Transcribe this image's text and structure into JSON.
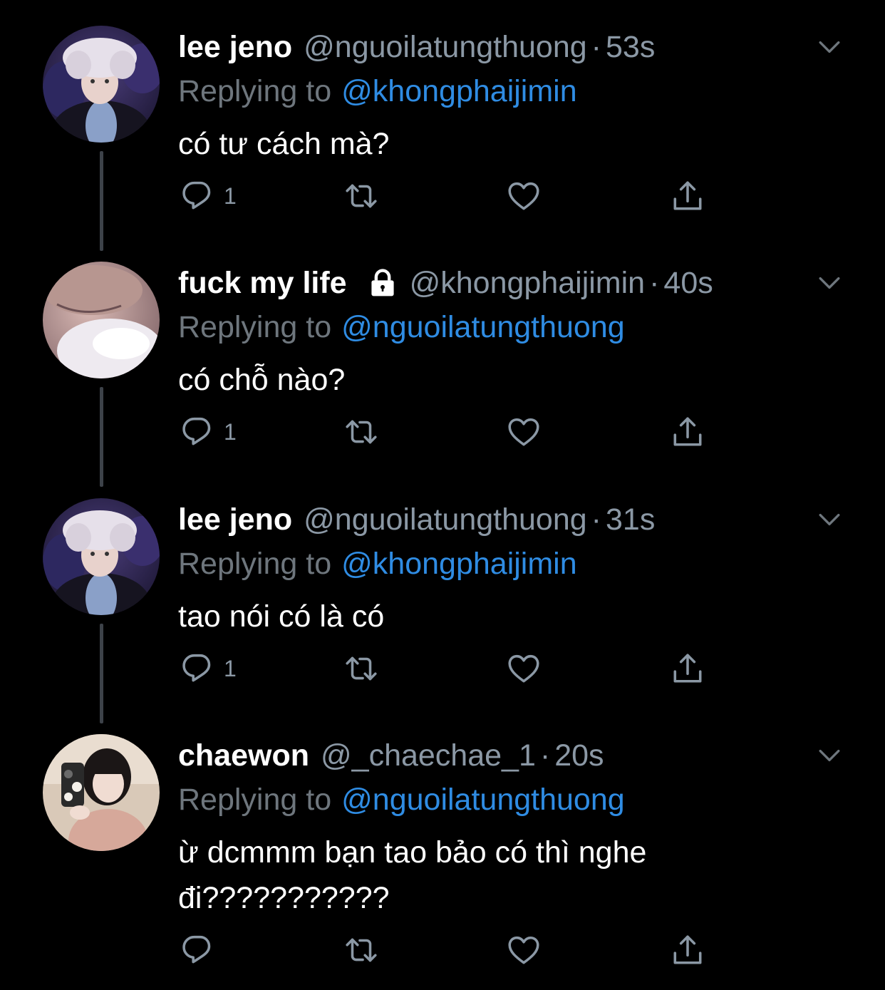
{
  "colors": {
    "background": "#000000",
    "name": "#ffffff",
    "secondary": "#8b98a5",
    "mention": "#2f8ce3",
    "thread_line": "#3d4249"
  },
  "tweets": [
    {
      "display_name": "lee jeno",
      "handle": "@nguoilatungthuong",
      "separator": "·",
      "time": "53s",
      "locked": false,
      "replying_label": "Replying to",
      "replying_to": "@khongphaijimin",
      "text": "có tư cách mà?",
      "reply_count": "1",
      "avatar": "avatar-lee-jeno"
    },
    {
      "display_name": "fuck my life",
      "handle": "@khongphaijimin",
      "separator": "·",
      "time": "40s",
      "locked": true,
      "replying_label": "Replying to",
      "replying_to": "@nguoilatungthuong",
      "text": "có chỗ nào?",
      "reply_count": "1",
      "avatar": "avatar-fuck-my-life"
    },
    {
      "display_name": "lee jeno",
      "handle": "@nguoilatungthuong",
      "separator": "·",
      "time": "31s",
      "locked": false,
      "replying_label": "Replying to",
      "replying_to": "@khongphaijimin",
      "text": "tao nói có là có",
      "reply_count": "1",
      "avatar": "avatar-lee-jeno"
    },
    {
      "display_name": "chaewon",
      "handle": "@_chaechae_1",
      "separator": "·",
      "time": "20s",
      "locked": false,
      "replying_label": "Replying to",
      "replying_to": "@nguoilatungthuong",
      "text_line1": "ừ dcmmm bạn tao bảo có thì nghe",
      "text_line2": "đi???????????",
      "reply_count": "",
      "avatar": "avatar-chaewon"
    }
  ],
  "icons": {
    "reply": "reply-icon",
    "retweet": "retweet-icon",
    "like": "heart-icon",
    "share": "share-icon",
    "more": "chevron-down-icon",
    "lock": "lock-icon"
  }
}
